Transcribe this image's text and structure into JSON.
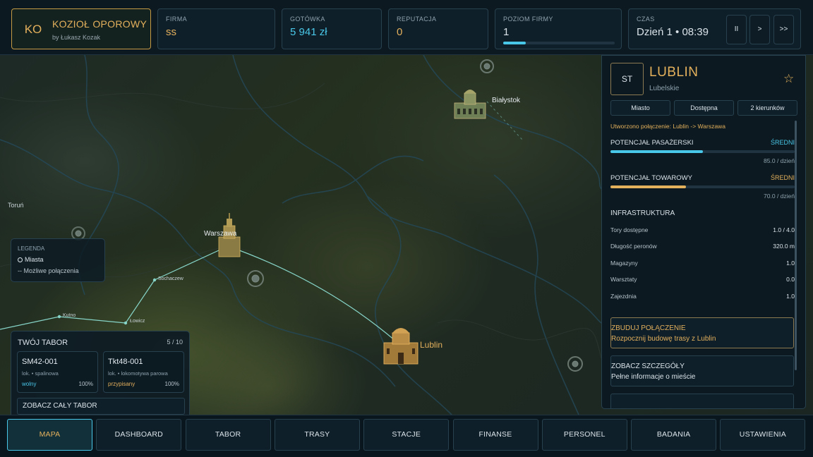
{
  "header": {
    "brand_initials": "KO",
    "brand_title": "KOZIOŁ OPOROWY",
    "brand_sub": "by Łukasz Kozak",
    "firma_label": "FIRMA",
    "firma_value": "ss",
    "cash_label": "GOTÓWKA",
    "cash_value": "5 941 zł",
    "rep_label": "REPUTACJA",
    "rep_value": "0",
    "level_label": "POZIOM FIRMY",
    "level_value": "1",
    "level_progress": 0.2,
    "time_label": "CZAS",
    "time_value": "Dzień 1 • 08:39",
    "btn_pause": "II",
    "btn_play": ">",
    "btn_fast": ">>"
  },
  "map": {
    "cities": {
      "bialystok": "Białystok",
      "warszawa": "Warszawa",
      "lublin": "Lublin",
      "torun": "Toruń",
      "sochaczew": "Sochaczew",
      "lowicz": "Łowicz",
      "kutno": "Kutno"
    }
  },
  "legend": {
    "title": "LEGENDA",
    "cities": "Miasta",
    "possible": "-- Możliwe połączenia"
  },
  "tabor": {
    "title": "TWÓJ TABOR",
    "count": "5 / 10",
    "vehicles": [
      {
        "name": "SM42-001",
        "type": "lok. • spalinowa",
        "status": "wolny",
        "pct": "100%"
      },
      {
        "name": "Tkt48-001",
        "type": "lok. • lokomotywa parowa",
        "status": "przypisany",
        "pct": "100%"
      }
    ],
    "see_all": "ZOBACZ CAŁY TABOR"
  },
  "panel": {
    "badge": "ST",
    "city": "LUBLIN",
    "region": "Lubelskie",
    "chips": [
      "Miasto",
      "Dostępna",
      "2 kierunków"
    ],
    "connection": "Utworzono połączenie: Lublin -> Warszawa",
    "passenger": {
      "label": "POTENCJAŁ PASAŻERSKI",
      "level": "ŚREDNI",
      "value": 0.5,
      "rate": "85.0 / dzień"
    },
    "freight": {
      "label": "POTENCJAŁ TOWAROWY",
      "level": "ŚREDNI",
      "value": 0.41,
      "rate": "70.0 / dzień"
    },
    "infra_title": "INFRASTRUKTURA",
    "infra": [
      {
        "label": "Tory dostępne",
        "value": "1.0 / 4.0"
      },
      {
        "label": "Długość peronów",
        "value": "320.0 m"
      },
      {
        "label": "Magazyny",
        "value": "1.0"
      },
      {
        "label": "Warsztaty",
        "value": "0.0"
      },
      {
        "label": "Zajezdnia",
        "value": "1.0"
      }
    ],
    "action_build_title": "ZBUDUJ POŁĄCZENIE",
    "action_build_sub": "Rozpocznij budowę trasy z Lublin",
    "action_details_title": "ZOBACZ SZCZEGÓŁY",
    "action_details_sub": "Pełne informacje o mieście",
    "colors": {
      "passenger": "#49c7e8",
      "freight": "#e3b05c"
    }
  },
  "nav": [
    "MAPA",
    "DASHBOARD",
    "TABOR",
    "TRASY",
    "STACJE",
    "FINANSE",
    "PERSONEL",
    "BADANIA",
    "USTAWIENIA"
  ]
}
